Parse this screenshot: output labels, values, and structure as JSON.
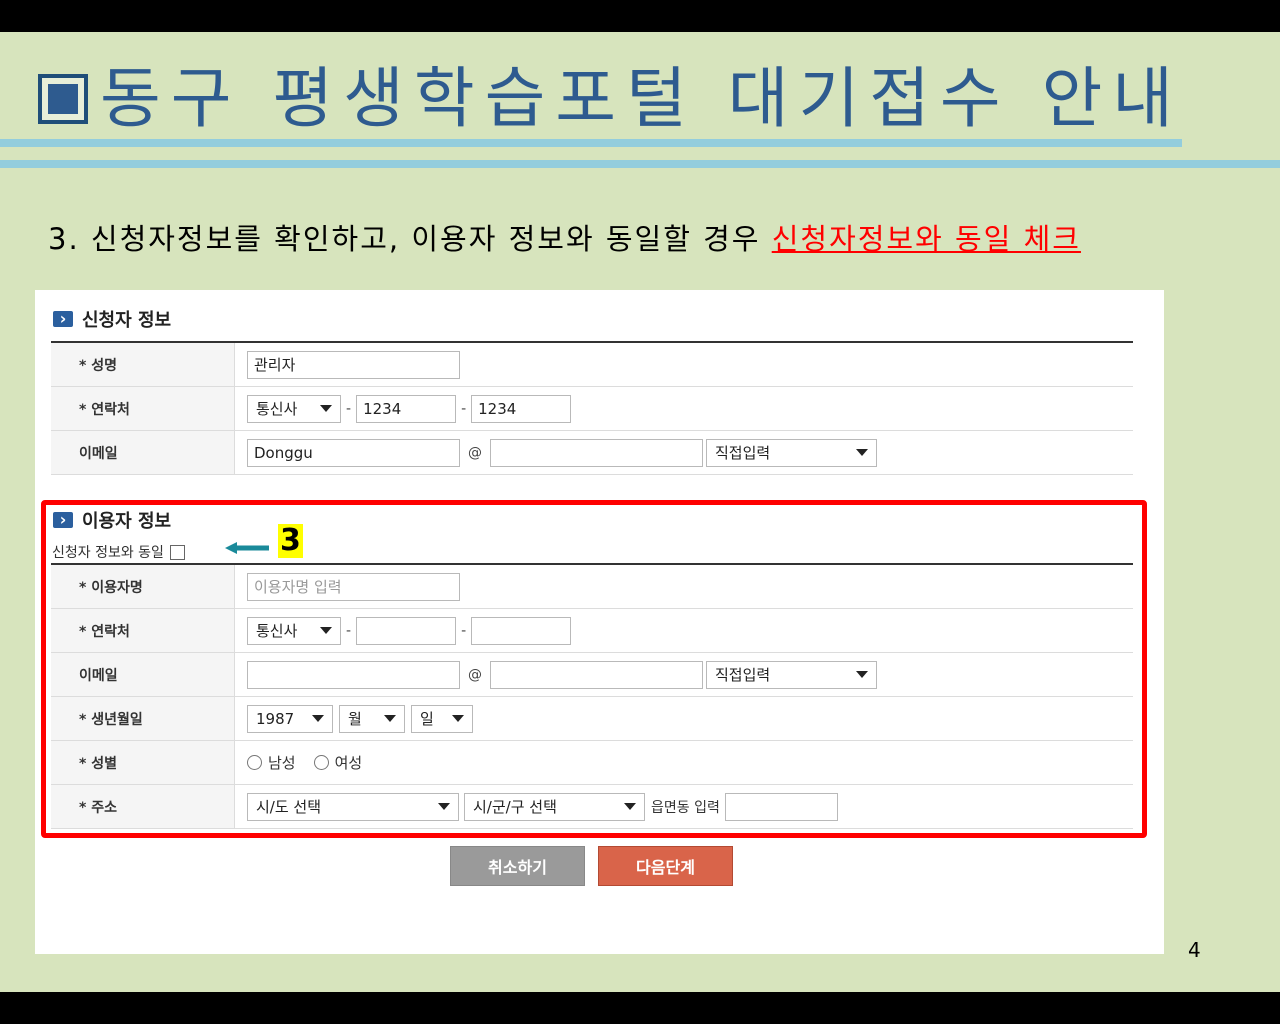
{
  "slide": {
    "title": "동구 평생학습포털 대기접수 안내",
    "instruction": {
      "text": "3. 신청자정보를 확인하고, 이용자 정보와 동일할 경우 ",
      "highlight": "신청자정보와 동일 체크"
    },
    "page_number": "4",
    "badge": "3"
  },
  "applicant": {
    "section_title": "신청자 정보",
    "name_label": "* 성명",
    "name_value": "관리자",
    "contact_label": "* 연락처",
    "carrier": "통신사",
    "phone_mid": "1234",
    "phone_last": "1234",
    "email_label": "이메일",
    "email_id": "Donggu",
    "at": "@",
    "email_domain": "",
    "email_select": "직접입력"
  },
  "user": {
    "section_title": "이용자 정보",
    "same_as_label": "신청자 정보와 동일",
    "name_label": "* 이용자명",
    "name_placeholder": "이용자명 입력",
    "contact_label": "* 연락처",
    "carrier": "통신사",
    "phone_mid": "",
    "phone_last": "",
    "email_label": "이메일",
    "email_id": "",
    "at": "@",
    "email_domain": "",
    "email_select": "직접입력",
    "birth_label": "* 생년월일",
    "birth_year": "1987",
    "birth_month": "월",
    "birth_day": "일",
    "gender_label": "* 성별",
    "gender_male": "남성",
    "gender_female": "여성",
    "address_label": "* 주소",
    "sido_select": "시/도 선택",
    "sigungu_select": "시/군/구 선택",
    "eup_label": "읍면동 입력",
    "eup_value": ""
  },
  "buttons": {
    "cancel": "취소하기",
    "next": "다음단계"
  },
  "colors": {
    "slide_bg": "#d7e4bd",
    "title": "#2e5b8f",
    "highlight_box": "#ff0000",
    "arrow": "#1a8a9a",
    "next_button": "#d9644a",
    "cancel_button": "#9a9a9a"
  }
}
